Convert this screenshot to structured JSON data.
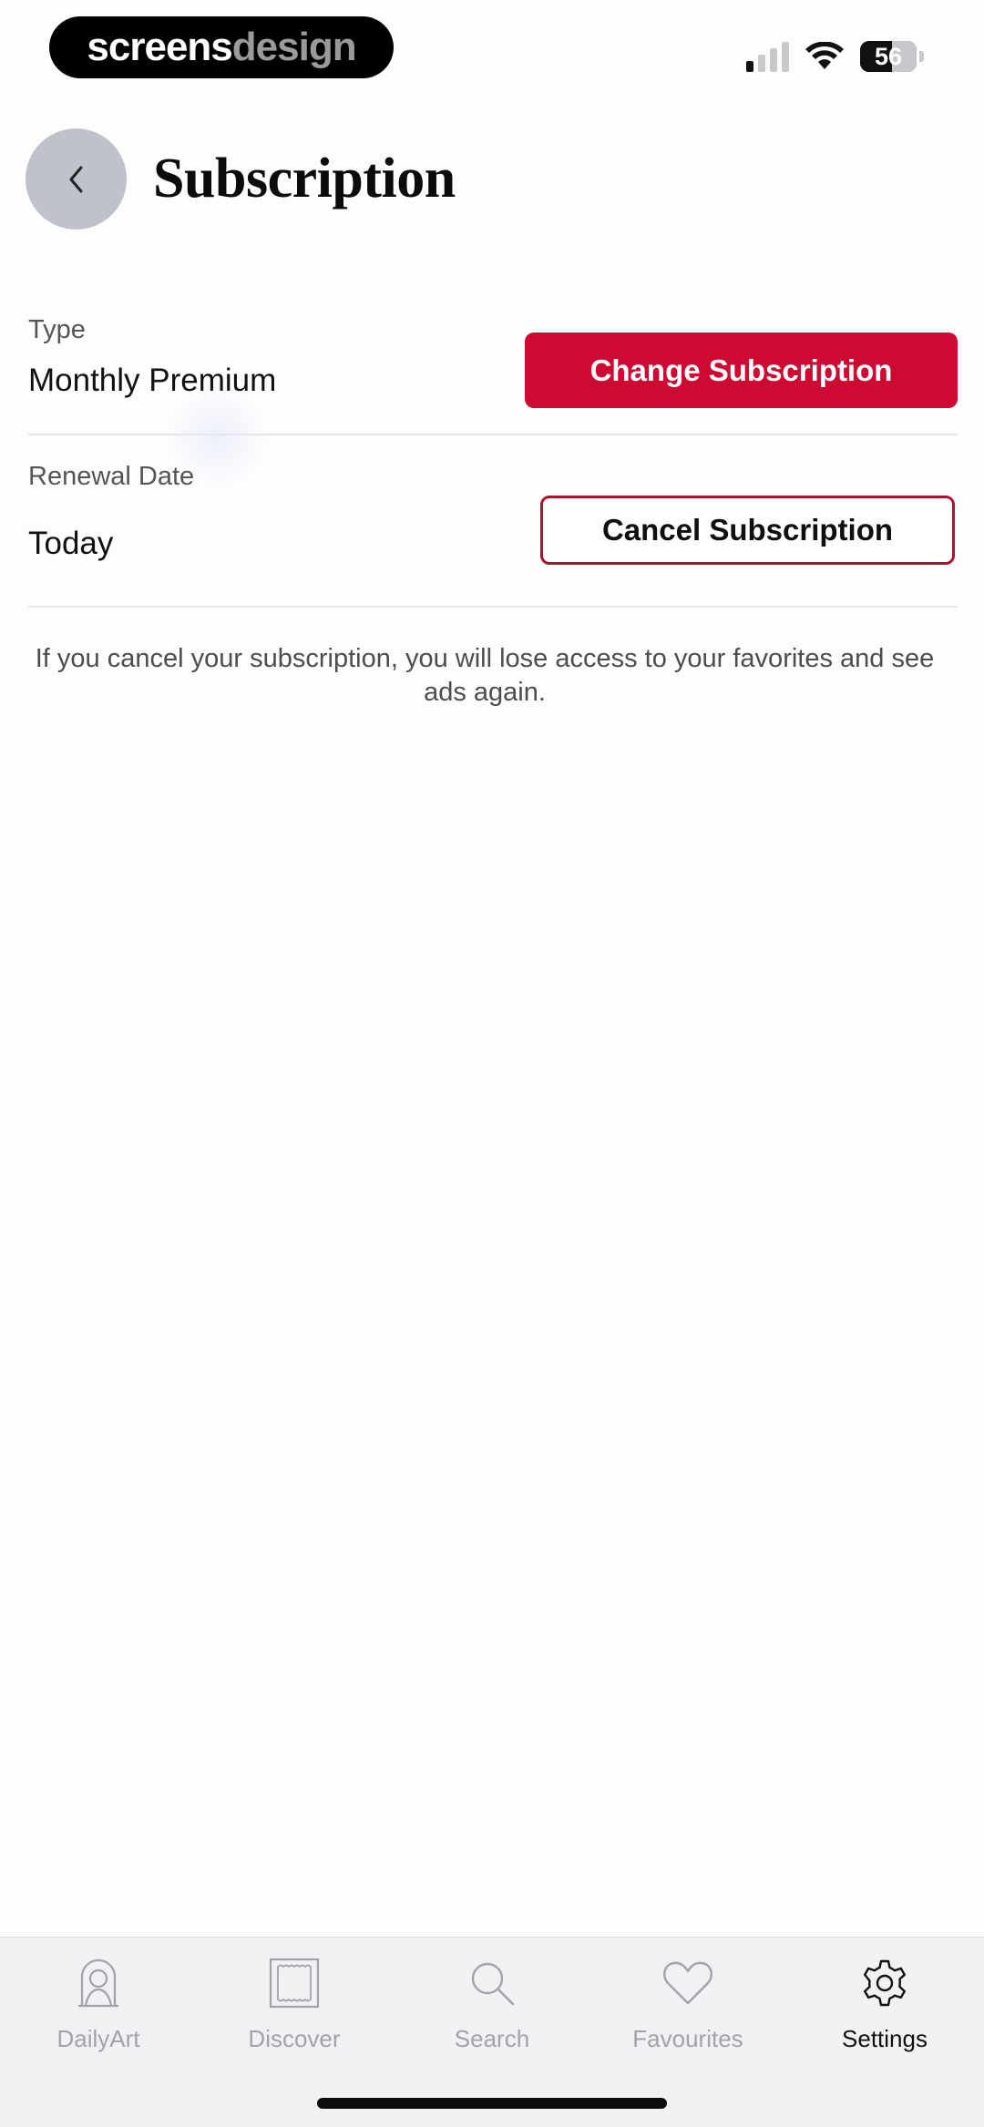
{
  "status_bar": {
    "brand_part1": "screens",
    "brand_part2": "design",
    "battery": "56",
    "signal_bars_active": 1,
    "signal_bars_total": 4
  },
  "header": {
    "title": "Subscription",
    "back_icon": "chevron-left-icon"
  },
  "subscription": {
    "type_label": "Type",
    "type_value": "Monthly Premium",
    "change_button": "Change Subscription",
    "renewal_label": "Renewal Date",
    "renewal_value": "Today",
    "cancel_button": "Cancel Subscription",
    "notice": "If you cancel your subscription, you will lose access to your favorites and see ads again."
  },
  "tab_bar": {
    "active": "settings",
    "items": [
      {
        "id": "dailyart",
        "label": "DailyArt",
        "icon": "portrait-icon"
      },
      {
        "id": "discover",
        "label": "Discover",
        "icon": "frame-icon"
      },
      {
        "id": "search",
        "label": "Search",
        "icon": "search-icon"
      },
      {
        "id": "favourites",
        "label": "Favourites",
        "icon": "heart-icon"
      },
      {
        "id": "settings",
        "label": "Settings",
        "icon": "gear-icon"
      }
    ]
  },
  "colors": {
    "accent": "#cc0a32",
    "inactive_tab": "#a2a2a8",
    "back_button": "#bfc2ca"
  }
}
